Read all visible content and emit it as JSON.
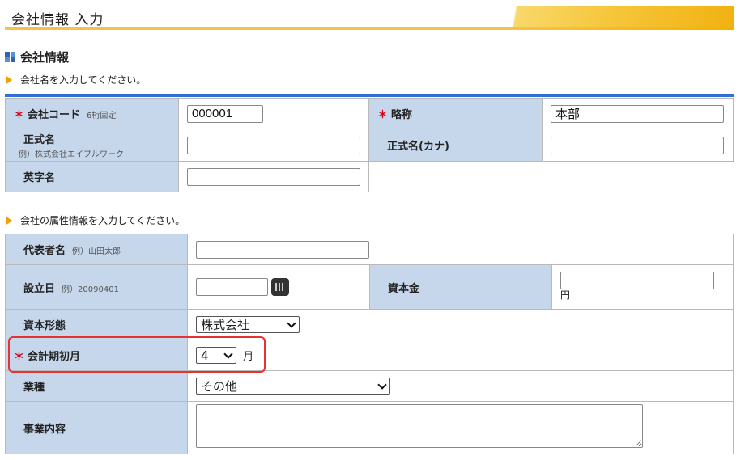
{
  "header": {
    "title": "会社情報 入力"
  },
  "section": {
    "title": "会社情報"
  },
  "hints": {
    "company_name": "会社名を入力してください。",
    "attributes": "会社の属性情報を入力してください。"
  },
  "required_mark": "＊",
  "company": {
    "code_label": "会社コード",
    "code_note": "6桁固定",
    "code_value": "000001",
    "short_label": "略称",
    "short_value": "本部",
    "official_label": "正式名",
    "official_example": "例）株式会社エイブルワーク",
    "official_value": "",
    "kana_label": "正式名(カナ)",
    "kana_value": "",
    "english_label": "英字名",
    "english_value": ""
  },
  "attributes": {
    "rep_label": "代表者名",
    "rep_example": "例）山田太郎",
    "rep_value": "",
    "founded_label": "設立日",
    "founded_example": "例）20090401",
    "founded_value": "",
    "capital_label": "資本金",
    "capital_value": "",
    "capital_unit": "円",
    "capital_form_label": "資本形態",
    "capital_form_value": "株式会社",
    "fiscal_label": "会計期初月",
    "fiscal_value": "4",
    "fiscal_unit": "月",
    "industry_label": "業種",
    "industry_value": "その他",
    "business_label": "事業内容",
    "business_value": ""
  },
  "colors": {
    "label_bg": "#c6d7ec",
    "accent_line": "#2f6fd6",
    "highlight": "#e53333",
    "required": "#d9001b"
  }
}
